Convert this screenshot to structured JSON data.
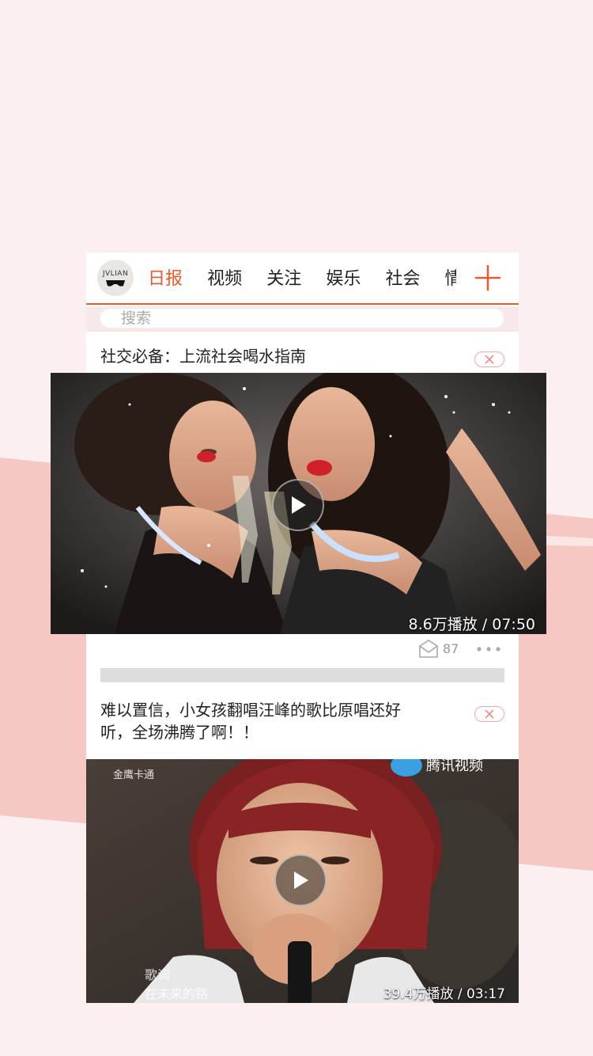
{
  "header": {
    "logo_text": "JVLIAN",
    "tabs": [
      {
        "label": "日报",
        "active": true
      },
      {
        "label": "视频",
        "active": false
      },
      {
        "label": "关注",
        "active": false
      },
      {
        "label": "娱乐",
        "active": false
      },
      {
        "label": "社会",
        "active": false
      },
      {
        "label": "情感",
        "active": false
      }
    ],
    "accent_color": "#ea5a2a",
    "add_icon": "plus-icon"
  },
  "search": {
    "placeholder": "搜索"
  },
  "feed": [
    {
      "title": "社交必备：上流社会喝水指南",
      "views_duration": "8.6万播放 / 07:50",
      "comments": "87"
    },
    {
      "title_line1": "难以置信，小女孩翻唱汪峰的歌比原唱还好",
      "title_line2": "听，全场沸腾了啊！！",
      "views_duration": "39.4万播放 / 03:17",
      "watermark_left": "金鹰卡通",
      "watermark_right": "腾讯视频",
      "caption_line1": "歌词",
      "caption_line2": "在未来的路"
    }
  ]
}
